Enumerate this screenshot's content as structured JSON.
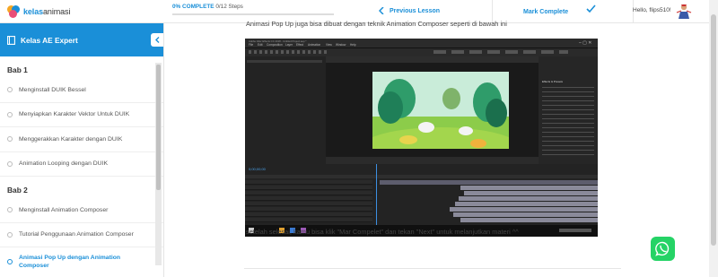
{
  "header": {
    "logo_text_brand": "kelas",
    "logo_text_rest": "animasi",
    "progress_label": "0% COMPLETE",
    "progress_steps": "0/12 Steps",
    "progress_fraction": 0,
    "prev_lesson_label": "Previous Lesson",
    "mark_complete_label": "Mark Complete",
    "greeting": "Hello, flips510!",
    "accent_color": "#1a8fd8"
  },
  "sidebar": {
    "course_title": "Kelas AE Expert",
    "sections": [
      {
        "title": "Bab 1",
        "lessons": [
          {
            "label": "Menginstall DUIK Bessel"
          },
          {
            "label": "Menyiapkan Karakter Vektor Untuk DUIK"
          },
          {
            "label": "Menggerakkan Karakter dengan DUIK"
          },
          {
            "label": "Animation Looping dengan DUIK"
          }
        ]
      },
      {
        "title": "Bab 2",
        "lessons": [
          {
            "label": "Menginstall Animation Composer"
          },
          {
            "label": "Tutorial Penggunaan Animation Composer"
          },
          {
            "label": "Animasi Pop Up dengan Animation Composer",
            "active": true
          }
        ]
      }
    ]
  },
  "content": {
    "intro_text": "Animasi Pop Up juga bisa dibuat dengan teknik Animation Composer seperti di bawah ini",
    "outro_text": "setelah selesai, kamu bisa klik \"Mar Compelet\" dan tekan \"Next\" untuk melanjutkan materi ^^",
    "screenshot": {
      "window_title": "Adobe After Effects CC 2018 - Untitled Project.aep *",
      "menu_items": [
        "File",
        "Edit",
        "Composition",
        "Layer",
        "Effect",
        "Animation",
        "View",
        "Window",
        "Help"
      ],
      "timecode": "0;00;00;00",
      "panel_title": "Effects & Presets"
    }
  },
  "icons": {
    "logo": "logo-mark-icon",
    "prev": "chevron-left-icon",
    "check": "check-icon",
    "book": "book-icon",
    "collapse": "chevron-left-icon",
    "whatsapp": "whatsapp-icon"
  }
}
